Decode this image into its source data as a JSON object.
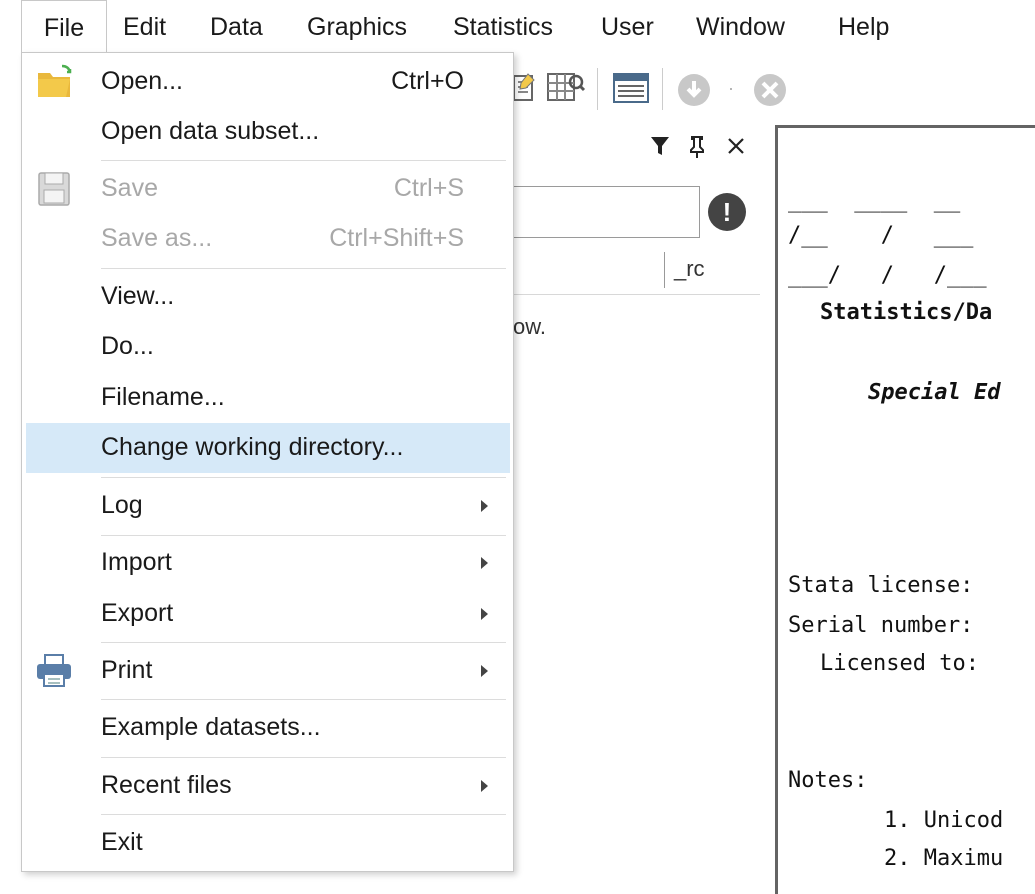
{
  "menubar": {
    "items": [
      "File",
      "Edit",
      "Data",
      "Graphics",
      "Statistics",
      "User",
      "Window",
      "Help"
    ]
  },
  "variables_pane": {
    "column_header": "_rc",
    "hint_fragment": "ow."
  },
  "results": {
    "lines": [
      "___  ____  __",
      "/__    /   ___",
      "___/   /   /___",
      "Statistics/Da",
      "Special Ed",
      "Stata license:",
      "Serial number:",
      "Licensed to:",
      "Notes:",
      "1. Unicod",
      "2. Maximu"
    ]
  },
  "file_menu": {
    "items": [
      {
        "label": "Open...",
        "shortcut": "Ctrl+O",
        "icon": "open-folder-icon",
        "disabled": false,
        "submenu": false
      },
      {
        "label": "Open data subset...",
        "shortcut": "",
        "disabled": false,
        "submenu": false
      },
      {
        "label": "Save",
        "shortcut": "Ctrl+S",
        "icon": "save-disk-icon",
        "disabled": true,
        "submenu": false
      },
      {
        "label": "Save as...",
        "shortcut": "Ctrl+Shift+S",
        "disabled": true,
        "submenu": false
      },
      {
        "label": "View...",
        "shortcut": "",
        "disabled": false,
        "submenu": false
      },
      {
        "label": "Do...",
        "shortcut": "",
        "disabled": false,
        "submenu": false
      },
      {
        "label": "Filename...",
        "shortcut": "",
        "disabled": false,
        "submenu": false
      },
      {
        "label": "Change working directory...",
        "shortcut": "",
        "disabled": false,
        "submenu": false,
        "highlighted": true
      },
      {
        "label": "Log",
        "shortcut": "",
        "disabled": false,
        "submenu": true
      },
      {
        "label": "Import",
        "shortcut": "",
        "disabled": false,
        "submenu": true
      },
      {
        "label": "Export",
        "shortcut": "",
        "disabled": false,
        "submenu": true
      },
      {
        "label": "Print",
        "shortcut": "",
        "icon": "printer-icon",
        "disabled": false,
        "submenu": true
      },
      {
        "label": "Example datasets...",
        "shortcut": "",
        "disabled": false,
        "submenu": false
      },
      {
        "label": "Recent files",
        "shortcut": "",
        "disabled": false,
        "submenu": true
      },
      {
        "label": "Exit",
        "shortcut": "",
        "disabled": false,
        "submenu": false
      }
    ]
  },
  "colors": {
    "highlight": "#d6e9f8",
    "disabled_text": "#a8a8a8",
    "folder": "#f3c94a"
  }
}
